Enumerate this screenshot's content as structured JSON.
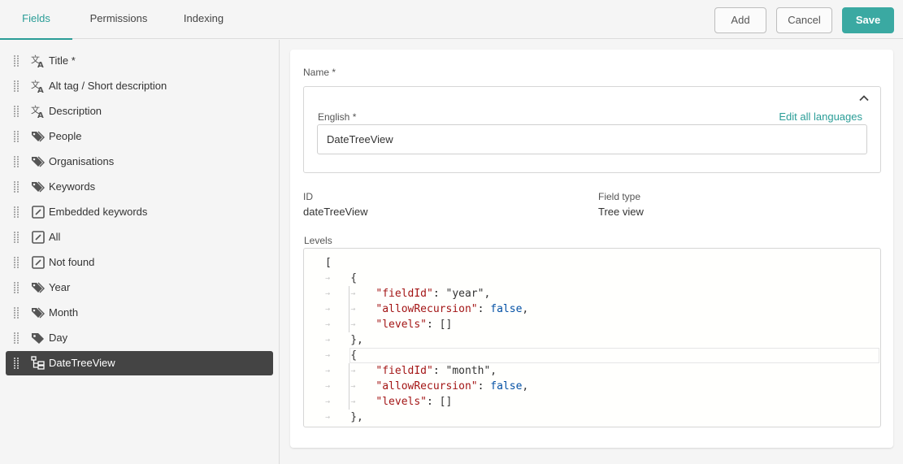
{
  "tabs": [
    {
      "label": "Fields",
      "active": true
    },
    {
      "label": "Permissions",
      "active": false
    },
    {
      "label": "Indexing",
      "active": false
    }
  ],
  "toolbar": {
    "add_label": "Add",
    "cancel_label": "Cancel",
    "save_label": "Save"
  },
  "colors": {
    "accent": "#2a9d97",
    "save_bg": "#3aa9a2",
    "selected_bg": "#444444"
  },
  "fields": [
    {
      "label": "Title *",
      "icon": "translate-icon"
    },
    {
      "label": "Alt tag / Short description",
      "icon": "translate-icon"
    },
    {
      "label": "Description",
      "icon": "translate-icon"
    },
    {
      "label": "People",
      "icon": "tags-icon"
    },
    {
      "label": "Organisations",
      "icon": "tags-icon"
    },
    {
      "label": "Keywords",
      "icon": "tags-icon"
    },
    {
      "label": "Embedded keywords",
      "icon": "edit-box-icon"
    },
    {
      "label": "All",
      "icon": "edit-box-icon"
    },
    {
      "label": "Not found",
      "icon": "edit-box-icon"
    },
    {
      "label": "Year",
      "icon": "tags-icon"
    },
    {
      "label": "Month",
      "icon": "tags-icon"
    },
    {
      "label": "Day",
      "icon": "tag-icon"
    },
    {
      "label": "DateTreeView",
      "icon": "tree-view-icon",
      "selected": true
    }
  ],
  "detail": {
    "name_label": "Name *",
    "english_label": "English *",
    "edit_all_languages": "Edit all languages",
    "english_value": "DateTreeView",
    "id_label": "ID",
    "id_value": "dateTreeView",
    "field_type_label": "Field type",
    "field_type_value": "Tree view",
    "levels_label": "Levels",
    "levels_code": [
      "[",
      "  {",
      "    \"fieldId\": \"year\",",
      "    \"allowRecursion\": false,",
      "    \"levels\": []",
      "  },",
      "  {",
      "    \"fieldId\": \"month\",",
      "    \"allowRecursion\": false,",
      "    \"levels\": []",
      "  },"
    ]
  }
}
